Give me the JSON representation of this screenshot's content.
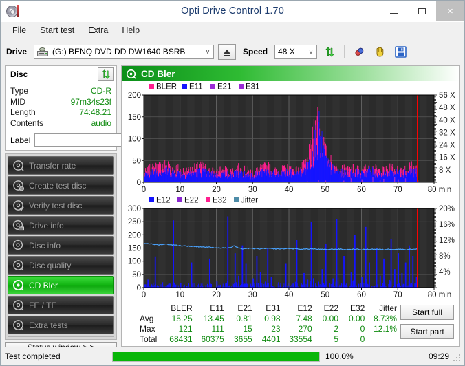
{
  "window": {
    "title": "Opti Drive Control 1.70",
    "icon": "optical-disc-icon",
    "minimize": "–",
    "maximize": "□",
    "close": "×"
  },
  "menu": {
    "items": [
      {
        "label": "File"
      },
      {
        "label": "Start test"
      },
      {
        "label": "Extra"
      },
      {
        "label": "Help"
      }
    ]
  },
  "toolbar": {
    "drive_label": "Drive",
    "drive_value": "(G:)   BENQ DVD DD DW1640 BSRB",
    "eject_icon": "eject-icon",
    "speed_label": "Speed",
    "speed_value": "48 X",
    "refresh_icon": "refresh-arrows-icon",
    "pills_icon": "pills-icon",
    "hand_icon": "hand-icon",
    "save_icon": "floppy-save-icon",
    "dropdown_arrow": "v"
  },
  "disc": {
    "title": "Disc",
    "refresh_icon": "refresh-arrows-icon",
    "rows": [
      {
        "key": "Type",
        "value": "CD-R"
      },
      {
        "key": "MID",
        "value": "97m34s23f"
      },
      {
        "key": "Length",
        "value": "74:48.21"
      },
      {
        "key": "Contents",
        "value": "audio"
      }
    ],
    "label_key": "Label",
    "label_value": "",
    "label_placeholder": "",
    "cd_button_icon": "cd-disc-icon"
  },
  "tests": {
    "items": [
      {
        "label": "Transfer rate",
        "icon": "disc-test-icon",
        "active": false
      },
      {
        "label": "Create test disc",
        "icon": "disc-write-icon",
        "active": false
      },
      {
        "label": "Verify test disc",
        "icon": "disc-verify-icon",
        "active": false
      },
      {
        "label": "Drive info",
        "icon": "drive-info-icon",
        "active": false
      },
      {
        "label": "Disc info",
        "icon": "disc-info-icon",
        "active": false
      },
      {
        "label": "Disc quality",
        "icon": "disc-quality-icon",
        "active": false
      },
      {
        "label": "CD Bler",
        "icon": "cd-bler-icon",
        "active": true
      },
      {
        "label": "FE / TE",
        "icon": "fe-te-icon",
        "active": false
      },
      {
        "label": "Extra tests",
        "icon": "extra-tests-icon",
        "active": false
      }
    ],
    "status_window_label": "Status window > >"
  },
  "panel": {
    "title": "CD Bler",
    "icon": "cd-bler-icon"
  },
  "actions": {
    "start_full": "Start full",
    "start_part": "Start part"
  },
  "stats": {
    "columns": [
      "BLER",
      "E11",
      "E21",
      "E31",
      "E12",
      "E22",
      "E32",
      "Jitter"
    ],
    "rows": [
      {
        "label": "Avg",
        "values": [
          "15.25",
          "13.45",
          "0.81",
          "0.98",
          "7.48",
          "0.00",
          "0.00",
          "8.73%"
        ]
      },
      {
        "label": "Max",
        "values": [
          "121",
          "111",
          "15",
          "23",
          "270",
          "2",
          "0",
          "12.1%"
        ]
      },
      {
        "label": "Total",
        "values": [
          "68431",
          "60375",
          "3655",
          "4401",
          "33554",
          "5",
          "0",
          ""
        ]
      }
    ]
  },
  "statusbar": {
    "message": "Test completed",
    "progress_percent": 100.0,
    "progress_text": "100.0%",
    "elapsed": "09:29"
  },
  "colors": {
    "bler": "#ff1f8f",
    "e11": "#1414ff",
    "e21": "#9a2bd6",
    "e31": "#9a2bd6",
    "e12": "#1414ff",
    "e22": "#8b28d0",
    "e32": "#ff1f8f",
    "jitter": "#4e8ca8",
    "jitter_line": "#4aa3ff",
    "scan_marker": "#ff0000",
    "plot_background": "#2a2a2a",
    "accent_green": "#0f8a0f",
    "axis_text": "#1a1a1a",
    "right_axis_text": "#2f2f2f"
  },
  "chart_data": [
    {
      "type": "area",
      "name": "CD Bler error rates",
      "title": "CD Bler",
      "xlabel": "min",
      "ylabel": "",
      "xlim": [
        0,
        80
      ],
      "ylim": [
        0,
        200
      ],
      "xticks": [
        0,
        10,
        20,
        30,
        40,
        50,
        60,
        70,
        80
      ],
      "xtick_labels": [
        "0",
        "10",
        "20",
        "30",
        "40",
        "50",
        "60",
        "70",
        "80 min"
      ],
      "yticks": [
        0,
        50,
        100,
        150,
        200
      ],
      "ytick_labels": [
        "0",
        "50",
        "100",
        "150",
        "200"
      ],
      "y2label": "X",
      "y2lim": [
        0,
        56
      ],
      "y2ticks": [
        8,
        16,
        24,
        32,
        40,
        48,
        56
      ],
      "y2tick_labels": [
        "8 X",
        "16 X",
        "24 X",
        "32 X",
        "40 X",
        "48 X",
        "56 X"
      ],
      "grid": true,
      "legend": [
        {
          "name": "BLER",
          "color": "#ff1f8f"
        },
        {
          "name": "E11",
          "color": "#1414ff"
        },
        {
          "name": "E21",
          "color": "#9a2bd6"
        },
        {
          "name": "E31",
          "color": "#9a2bd6"
        }
      ],
      "data_end_min": 75.4,
      "marker_min": 75.4,
      "series": [
        {
          "name": "BLER",
          "color": "#ff1f8f",
          "x": [
            0,
            2,
            4,
            6,
            8,
            10,
            12,
            14,
            16,
            18,
            20,
            22,
            24,
            26,
            28,
            30,
            32,
            34,
            36,
            38,
            40,
            42,
            44,
            45,
            46,
            47,
            47.5,
            48,
            48.5,
            49,
            49.5,
            50,
            51,
            52,
            53,
            54,
            56,
            58,
            60,
            62,
            64,
            66,
            68,
            70,
            72,
            74,
            75.4
          ],
          "values": [
            18,
            26,
            30,
            34,
            28,
            24,
            22,
            26,
            30,
            22,
            20,
            24,
            21,
            26,
            22,
            20,
            24,
            30,
            21,
            23,
            26,
            22,
            30,
            40,
            62,
            95,
            112,
            121,
            104,
            86,
            70,
            55,
            42,
            33,
            28,
            26,
            22,
            26,
            22,
            30,
            24,
            22,
            26,
            24,
            28,
            30,
            26
          ]
        },
        {
          "name": "E11",
          "color": "#1414ff",
          "x": [
            0,
            2,
            4,
            6,
            8,
            10,
            12,
            14,
            16,
            18,
            20,
            22,
            24,
            26,
            28,
            30,
            32,
            34,
            36,
            38,
            40,
            42,
            44,
            45,
            46,
            47,
            47.5,
            48,
            48.5,
            49,
            49.5,
            50,
            51,
            52,
            53,
            54,
            56,
            58,
            60,
            62,
            64,
            66,
            68,
            70,
            72,
            74,
            75.4
          ],
          "values": [
            14,
            20,
            24,
            26,
            22,
            18,
            17,
            20,
            23,
            17,
            16,
            18,
            16,
            20,
            17,
            15,
            18,
            23,
            16,
            18,
            20,
            17,
            24,
            33,
            52,
            80,
            96,
            111,
            92,
            74,
            60,
            46,
            34,
            27,
            23,
            21,
            17,
            21,
            17,
            24,
            19,
            17,
            21,
            19,
            22,
            24,
            21
          ]
        },
        {
          "name": "E21",
          "color": "#9a2bd6",
          "x": [
            0,
            10,
            20,
            30,
            40,
            45,
            48,
            50,
            55,
            57,
            60,
            63,
            66,
            69,
            72,
            75.4
          ],
          "values": [
            1,
            1,
            1,
            1,
            1,
            2,
            6,
            4,
            3,
            9,
            7,
            11,
            8,
            12,
            9,
            6
          ]
        },
        {
          "name": "E31",
          "color": "#9a2bd6",
          "x": [
            0,
            10,
            20,
            30,
            40,
            48,
            55,
            60,
            65,
            70,
            75.4
          ],
          "values": [
            1,
            1,
            1,
            1,
            1,
            5,
            4,
            6,
            5,
            7,
            5
          ]
        }
      ]
    },
    {
      "type": "area",
      "name": "CD Bler E12/E22/E32 and Jitter",
      "title": "",
      "xlabel": "min",
      "ylabel": "",
      "xlim": [
        0,
        80
      ],
      "ylim": [
        0,
        300
      ],
      "xticks": [
        0,
        10,
        20,
        30,
        40,
        50,
        60,
        70,
        80
      ],
      "xtick_labels": [
        "0",
        "10",
        "20",
        "30",
        "40",
        "50",
        "60",
        "70",
        "80 min"
      ],
      "yticks": [
        0,
        50,
        100,
        150,
        200,
        250,
        300
      ],
      "ytick_labels": [
        "0",
        "50",
        "100",
        "150",
        "200",
        "250",
        "300"
      ],
      "y2label": "%",
      "y2lim": [
        0,
        20
      ],
      "y2ticks": [
        4,
        8,
        12,
        16,
        20
      ],
      "y2tick_labels": [
        "4%",
        "8%",
        "12%",
        "16%",
        "20%"
      ],
      "grid": true,
      "legend": [
        {
          "name": "E12",
          "color": "#1414ff"
        },
        {
          "name": "E22",
          "color": "#8b28d0"
        },
        {
          "name": "E32",
          "color": "#ff1f8f"
        },
        {
          "name": "Jitter",
          "color": "#4e8ca8"
        }
      ],
      "data_end_min": 75.4,
      "marker_min": 75.4,
      "series": [
        {
          "name": "E12",
          "color": "#1414ff",
          "x": [
            1,
            2,
            3,
            5,
            6,
            8,
            10,
            11,
            13,
            15,
            16,
            18,
            20,
            21,
            23,
            25,
            26,
            27,
            28,
            30,
            31,
            32,
            34,
            35,
            37,
            39,
            41,
            42,
            44,
            45,
            46,
            48,
            49,
            50,
            52,
            53,
            55,
            57,
            58,
            60,
            61,
            62,
            64,
            65,
            66,
            68,
            69,
            70,
            71,
            72,
            73,
            74,
            75
          ],
          "values": [
            30,
            12,
            118,
            20,
            8,
            255,
            18,
            10,
            95,
            14,
            8,
            110,
            25,
            10,
            270,
            130,
            45,
            160,
            90,
            35,
            120,
            60,
            150,
            40,
            20,
            90,
            15,
            180,
            55,
            30,
            250,
            22,
            70,
            165,
            35,
            260,
            120,
            60,
            200,
            40,
            230,
            95,
            150,
            45,
            110,
            185,
            70,
            130,
            55,
            95,
            160,
            120,
            40
          ]
        },
        {
          "name": "E22",
          "color": "#8b28d0",
          "x": [
            18,
            52
          ],
          "values": [
            2,
            1
          ]
        },
        {
          "name": "E32",
          "color": "#ff1f8f",
          "x": [],
          "values": []
        },
        {
          "name": "Jitter",
          "color": "#4aa3ff",
          "unit": "percent",
          "x": [
            0,
            1,
            2,
            3,
            4,
            5,
            6,
            7,
            8,
            9,
            10,
            12,
            14,
            16,
            18,
            20,
            22,
            24,
            25,
            26,
            27,
            28,
            30,
            32,
            34,
            36,
            38,
            40,
            42,
            44,
            46,
            48,
            50,
            52,
            54,
            56,
            58,
            60,
            62,
            64,
            66,
            68,
            70,
            72,
            74,
            75.4
          ],
          "values": [
            11.1,
            11.2,
            11.0,
            10.9,
            10.8,
            10.9,
            11.0,
            10.9,
            10.8,
            10.7,
            10.6,
            10.5,
            10.4,
            10.3,
            10.2,
            10.1,
            10.0,
            10.1,
            10.6,
            10.0,
            9.8,
            9.9,
            9.9,
            9.8,
            9.9,
            9.8,
            9.8,
            9.9,
            9.8,
            9.7,
            9.8,
            9.7,
            9.6,
            9.7,
            9.7,
            9.6,
            9.7,
            9.6,
            9.7,
            9.7,
            9.6,
            9.7,
            9.7,
            9.6,
            9.7,
            9.8
          ]
        }
      ]
    }
  ]
}
